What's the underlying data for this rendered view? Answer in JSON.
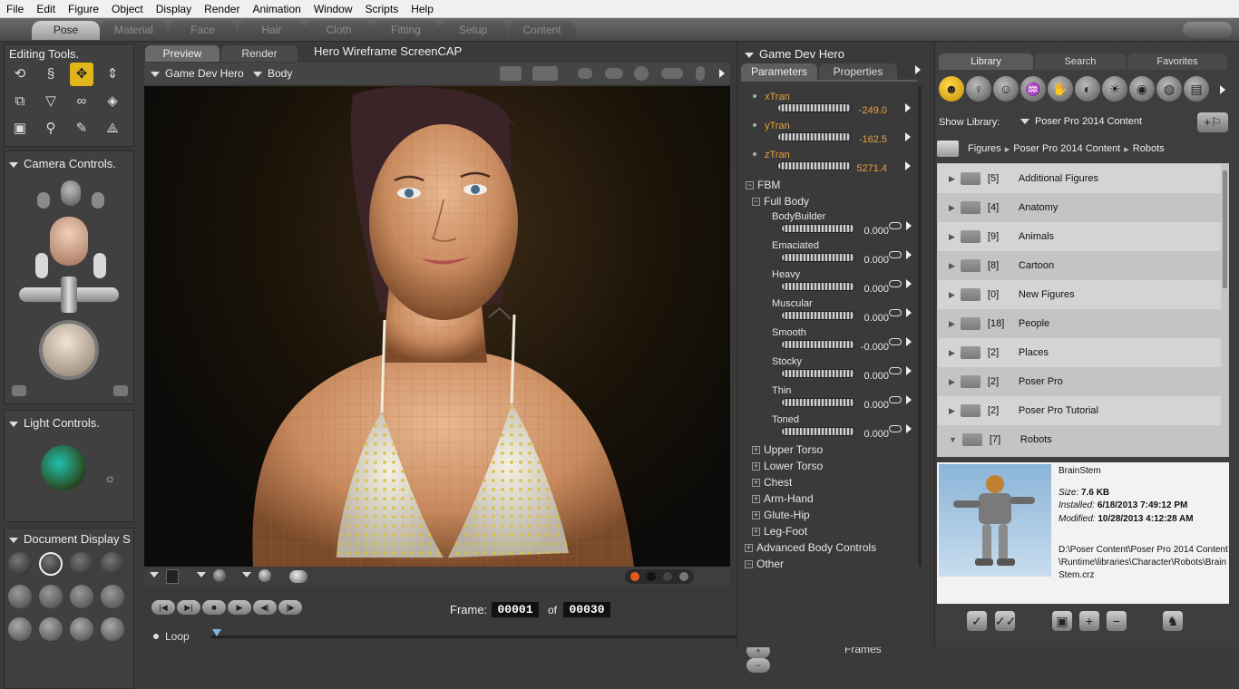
{
  "menu": [
    "File",
    "Edit",
    "Figure",
    "Object",
    "Display",
    "Render",
    "Animation",
    "Window",
    "Scripts",
    "Help"
  ],
  "rooms": [
    "Pose",
    "Material",
    "Face",
    "Hair",
    "Cloth",
    "Fitting",
    "Setup",
    "Content"
  ],
  "active_room": "Pose",
  "left": {
    "editing_tools_title": "Editing Tools.",
    "camera_controls_title": "Camera Controls.",
    "light_controls_title": "Light Controls.",
    "document_display_title": "Document Display S"
  },
  "viewport": {
    "tabs": [
      "Preview",
      "Render"
    ],
    "active_tab": "Preview",
    "title_line": "Hero  Wireframe  ScreenCAP",
    "figure_menu": "Game Dev Hero",
    "part_menu": "Body"
  },
  "animation": {
    "frame_label": "Frame:",
    "frame_current": "00001",
    "of_label": "of",
    "frame_total": "00030",
    "loop_label": "Loop",
    "skip_frames_label": "Skip Frames"
  },
  "params": {
    "figure_title": "Game Dev Hero",
    "tabs": [
      "Parameters",
      "Properties"
    ],
    "active_tab": "Parameters",
    "translations": [
      {
        "name": "xTran",
        "value": "-249.0"
      },
      {
        "name": "yTran",
        "value": "-162.5"
      },
      {
        "name": "zTran",
        "value": "5271.4"
      }
    ],
    "fbm_group": "FBM",
    "full_body_group": "Full Body",
    "morphs": [
      {
        "name": "BodyBuilder",
        "value": "0.000"
      },
      {
        "name": "Emaciated",
        "value": "0.000"
      },
      {
        "name": "Heavy",
        "value": "0.000"
      },
      {
        "name": "Muscular",
        "value": "0.000"
      },
      {
        "name": "Smooth",
        "value": "-0.000"
      },
      {
        "name": "Stocky",
        "value": "0.000"
      },
      {
        "name": "Thin",
        "value": "0.000"
      },
      {
        "name": "Toned",
        "value": "0.000"
      }
    ],
    "subgroups": [
      "Upper Torso",
      "Lower Torso",
      "Chest",
      "Arm-Hand",
      "Glute-Hip",
      "Leg-Foot"
    ],
    "advanced": "Advanced Body Controls",
    "other": "Other"
  },
  "library": {
    "tabs": [
      "Library",
      "Search",
      "Favorites"
    ],
    "active_tab": "Library",
    "show_library_label": "Show Library:",
    "show_library_value": "Poser Pro 2014 Content",
    "breadcrumb": [
      "Figures",
      "Poser Pro 2014 Content",
      "Robots"
    ],
    "folders": [
      {
        "count": "[5]",
        "name": "Additional Figures"
      },
      {
        "count": "[4]",
        "name": "Anatomy"
      },
      {
        "count": "[9]",
        "name": "Animals"
      },
      {
        "count": "[8]",
        "name": "Cartoon"
      },
      {
        "count": "[0]",
        "name": "New Figures"
      },
      {
        "count": "[18]",
        "name": "People"
      },
      {
        "count": "[2]",
        "name": "Places"
      },
      {
        "count": "[2]",
        "name": "Poser Pro"
      },
      {
        "count": "[2]",
        "name": "Poser Pro Tutorial"
      },
      {
        "count": "[7]",
        "name": "Robots"
      }
    ],
    "item": {
      "name": "BrainStem",
      "size_label": "Size:",
      "size": "7.6 KB",
      "installed_label": "Installed:",
      "installed": "6/18/2013 7:49:12 PM",
      "modified_label": "Modified:",
      "modified": "10/28/2013 4:12:28 AM",
      "path": "D:\\Poser Content\\Poser Pro 2014 Content\\Runtime\\libraries\\Character\\Robots\\BrainStem.crz"
    }
  },
  "colors": {
    "accent_yellow": "#e2b51b",
    "value_orange": "#e7a23a",
    "panel_bg": "#3d3d3d"
  }
}
